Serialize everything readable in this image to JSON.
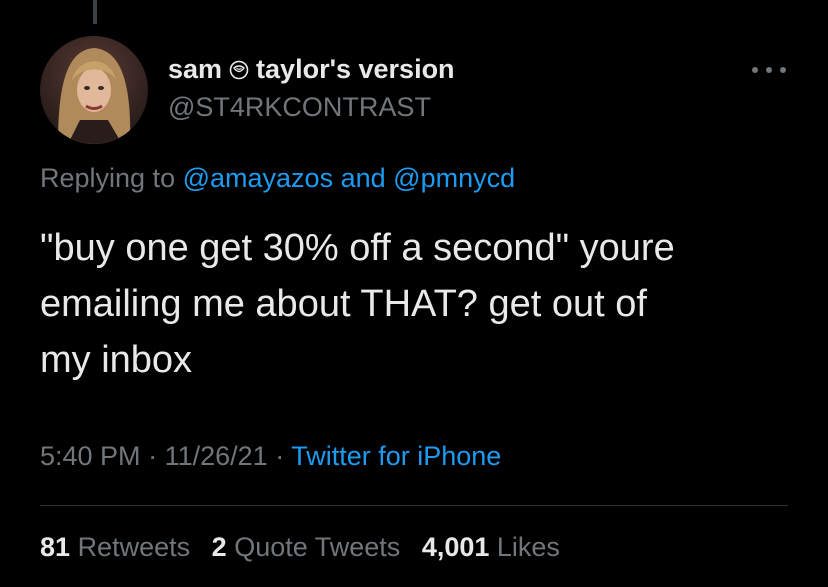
{
  "tweet": {
    "author": {
      "name_part1": "sam",
      "name_part2": "taylor's version",
      "handle": "@ST4RKCONTRAST",
      "name_emoji_icon": "rose-emoji-icon"
    },
    "reply": {
      "prefix": "Replying to",
      "user1": "@amayazos",
      "conjunction": "and",
      "user2": "@pmnycd"
    },
    "text": "\"buy one get 30% off a second\" youre\nemailing me about THAT? get out of\nmy inbox",
    "meta": {
      "time": "5:40 PM",
      "separator": "·",
      "date": "11/26/21",
      "source": "Twitter for iPhone"
    },
    "stats": {
      "retweets_count": "81",
      "retweets_label": "Retweets",
      "quotes_count": "2",
      "quotes_label": "Quote Tweets",
      "likes_count": "4,001",
      "likes_label": "Likes"
    }
  },
  "colors": {
    "background": "#000000",
    "primary_text": "#e7e9ea",
    "secondary_text": "#71767b",
    "link": "#1d9bf0",
    "divider": "#2f3336"
  }
}
